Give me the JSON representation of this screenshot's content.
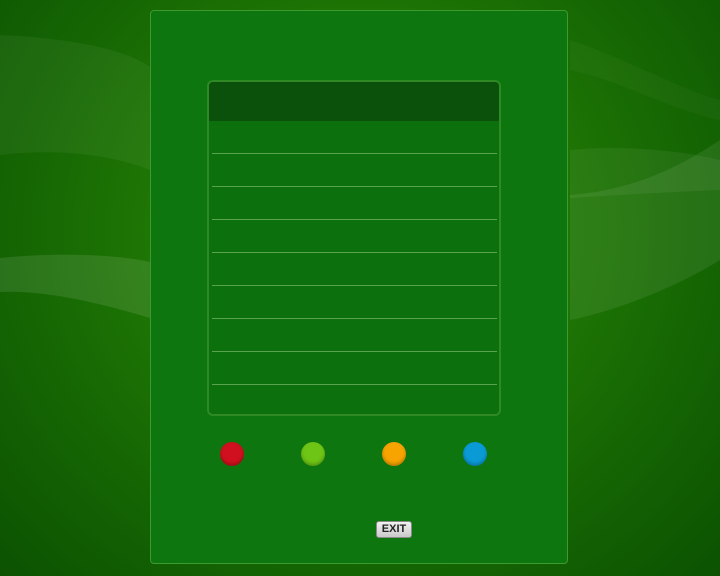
{
  "colors": {
    "background": "#217a05",
    "panel": "#0e760e",
    "list_header": "#0b510b",
    "row_divider": "#5aa34e"
  },
  "list": {
    "rows": [
      "",
      "",
      "",
      "",
      "",
      "",
      "",
      "",
      ""
    ]
  },
  "color_buttons": [
    {
      "name": "red",
      "color": "#d0101e"
    },
    {
      "name": "green",
      "color": "#6fc515"
    },
    {
      "name": "yellow",
      "color": "#f7a300"
    },
    {
      "name": "blue",
      "color": "#0a9ad6"
    }
  ],
  "exit": {
    "label": "EXIT"
  }
}
